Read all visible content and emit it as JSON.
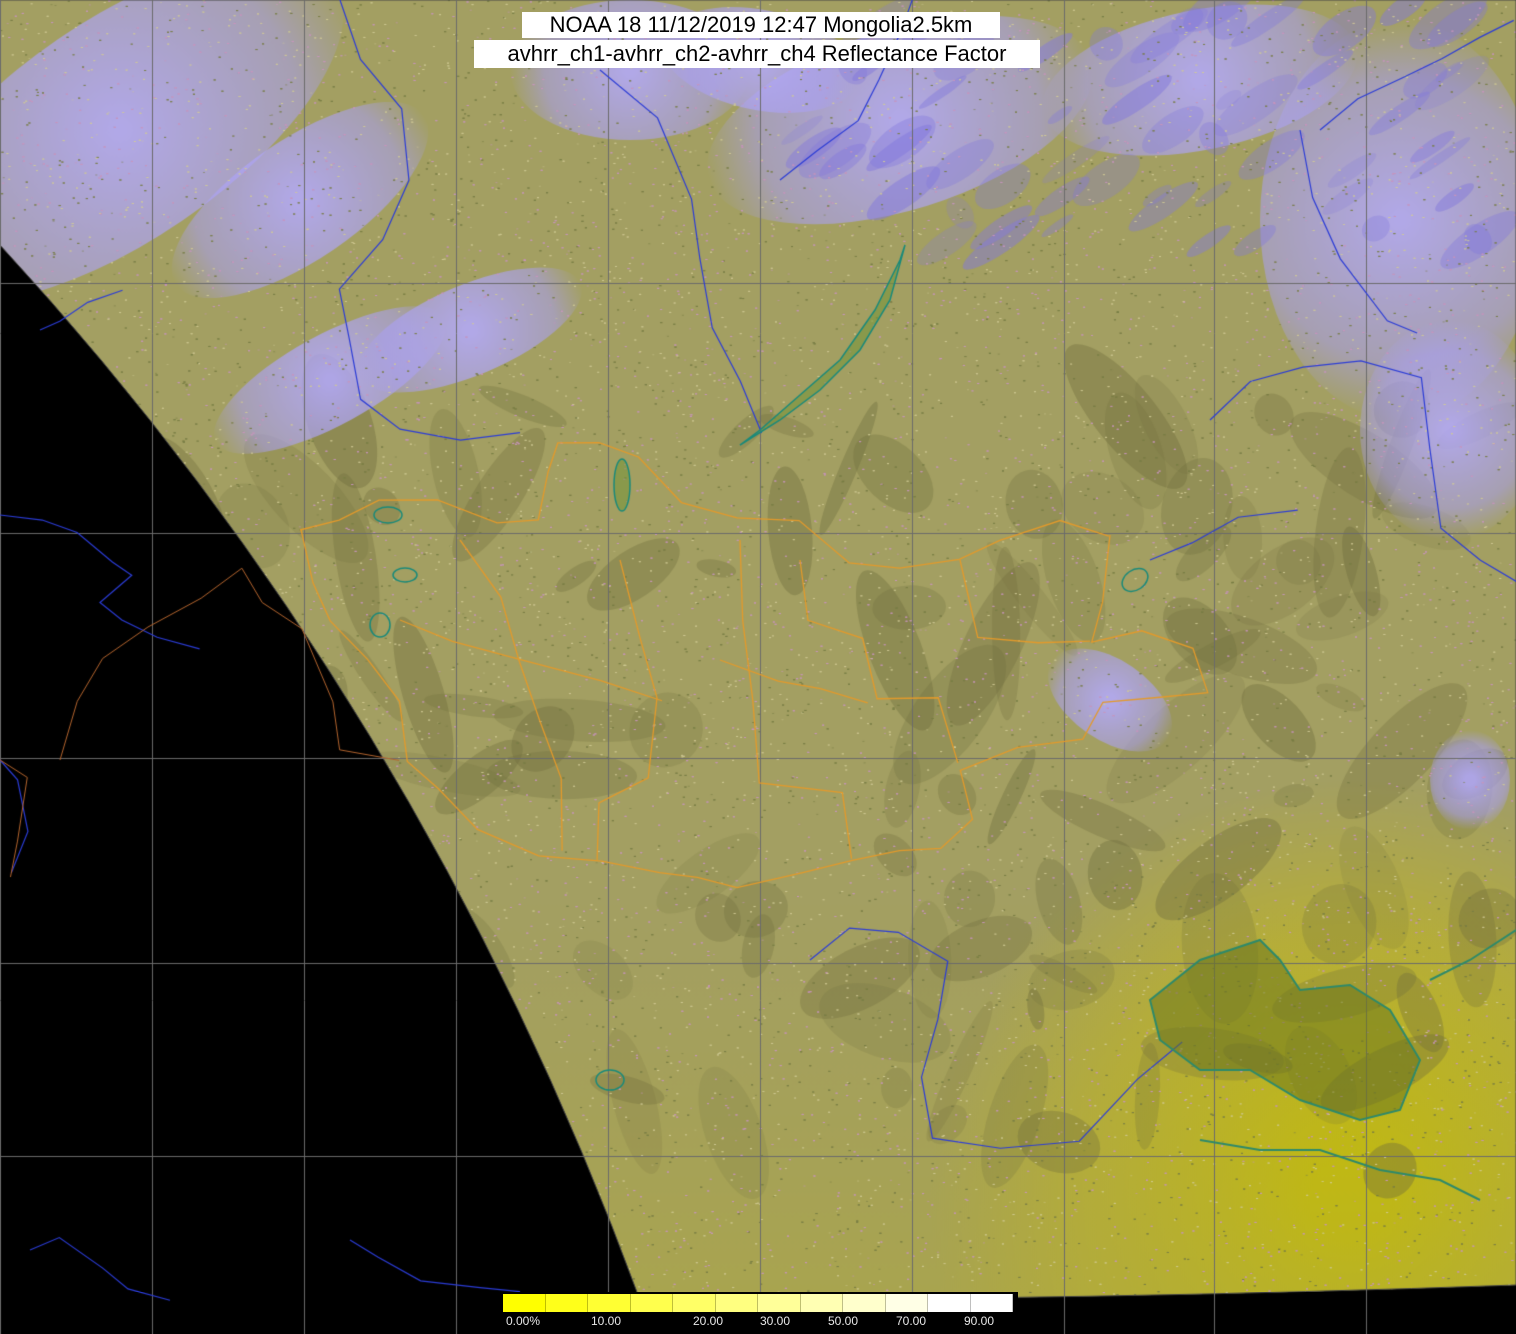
{
  "header": {
    "title": "NOAA 18 11/12/2019 12:47 Mongolia2.5km",
    "subtitle": "avhrr_ch1-avhrr_ch2-avhrr_ch4 Reflectance Factor"
  },
  "colorbar": {
    "ticks": [
      {
        "label": "0.00%",
        "value": 0
      },
      {
        "label": "10.00",
        "value": 10
      },
      {
        "label": "20.00",
        "value": 20
      },
      {
        "label": "30.00",
        "value": 30
      },
      {
        "label": "50.00",
        "value": 50
      },
      {
        "label": "70.00",
        "value": 70
      },
      {
        "label": "90.00",
        "value": 90
      }
    ],
    "colors": [
      "#ffff00",
      "#ffff1a",
      "#ffff33",
      "#ffff4d",
      "#ffff66",
      "#ffff80",
      "#ffff99",
      "#ffffb3",
      "#ffffcc",
      "#ffffe6",
      "#ffffff",
      "#ffffff"
    ]
  },
  "map_colors": {
    "no_data": "#000000",
    "land": "#a39f62",
    "land_dark": "#7d7a3e",
    "cloud": "#b3a8ff",
    "cloud_dark": "#8a7ed6",
    "lowland_yellow": "#c9c000",
    "graticule": "#6b6b6b",
    "rivers": "#2b3cd6",
    "province_borders": "#e39a2b",
    "country_borders": "#b5652e",
    "lakes": "#1a8a7a"
  }
}
